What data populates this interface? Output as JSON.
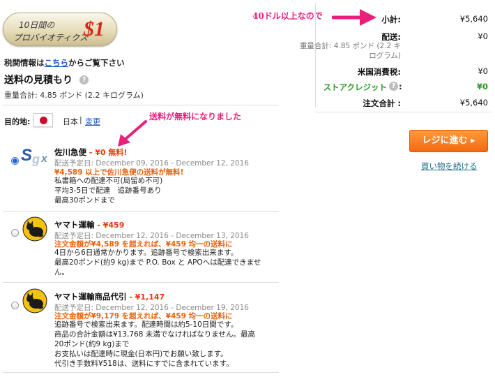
{
  "promo": {
    "line1": "10日間の",
    "line2": "プロバイオティクス",
    "amount": "$1"
  },
  "tax_info": {
    "prefix": "税関情報は",
    "link": "こちら",
    "suffix": "からご覧下さい"
  },
  "shipping_estimate": {
    "title": "送料の見積もり",
    "help_icon": "?",
    "weight_text": "重量合計: 4.85 ポンド (2.2 キログラム)"
  },
  "destination": {
    "label": "目的地:",
    "country": "日本",
    "separator": "|",
    "change_link": "変更",
    "flag_icon": "japan-flag-icon"
  },
  "annotations": {
    "free_shipping": "送料が無料になりました",
    "over_40": "40ドル以上なので"
  },
  "carriers": [
    {
      "name": "佐川急便",
      "dash": " - ",
      "price": "¥0 無料!",
      "selected": true,
      "logo_icon": "sagawa-logo-icon",
      "delivery": "配送予定日: December 09, 2016 - December 12, 2016",
      "highlight": "¥4,589 以上で佐川急便の送料が無料!",
      "notes": [
        "私書箱への配達不可(局留め不可)",
        "平均3-5日で配達　追跡番号あり",
        "最高30ポンドまで"
      ]
    },
    {
      "name": "ヤマト運輸",
      "dash": " - ",
      "price": "¥459",
      "selected": false,
      "logo_icon": "yamato-cat-logo-icon",
      "delivery": "配送予定日: December 12, 2016 - December 13, 2016",
      "highlight": "注文金額が¥4,589 を超えれば、¥459 均一の送料に",
      "notes": [
        "4日から6日通常かかります。追跡番号で検索出来ます。",
        "最高20ポンド(約9 kg)まで P.O. Box と APOへは配達できませ",
        "ん。"
      ]
    },
    {
      "name": "ヤマト運輸商品代引",
      "dash": " - ",
      "price": "¥1,147",
      "selected": false,
      "logo_icon": "yamato-cat-logo-icon",
      "delivery": "配送予定日: December 12, 2016 - December 19, 2016",
      "highlight": "注文金額が¥9,179 を超えれば、¥459 均一の送料に",
      "notes": [
        "追跡番号で検索出来ます。配達時間は約5-10日間です。",
        "商品の合計金額は¥13,768 未満でなければなりません。最高",
        "20ポンド(約9 kg)まで",
        "お支払いは配達時に現金(日本円)でお願い致します。",
        "代引き手数料¥518は、送料にすでに含まれています。"
      ]
    }
  ],
  "summary": {
    "subtotal_label": "小計:",
    "subtotal_value": "¥5,640",
    "shipping_label": "配送:",
    "shipping_value": "¥0",
    "shipping_sub1": "重量合計: 4.85 ポンド (2.2 キ",
    "shipping_sub2": "ログラム)",
    "tax_label": "米国消費税:",
    "tax_value": "¥0",
    "credit_label": "ストアクレジット",
    "credit_value": "¥0",
    "total_label": "注文合計 :",
    "total_value": "¥5,640"
  },
  "actions": {
    "checkout": "レジに進む ▸",
    "continue": "買い物を続ける"
  },
  "colors": {
    "accent_orange": "#f26a10",
    "link_blue": "#1a56c8",
    "annotation_pink": "#e8207a",
    "credit_green": "#2a9a28",
    "price_red": "#e8380d"
  }
}
